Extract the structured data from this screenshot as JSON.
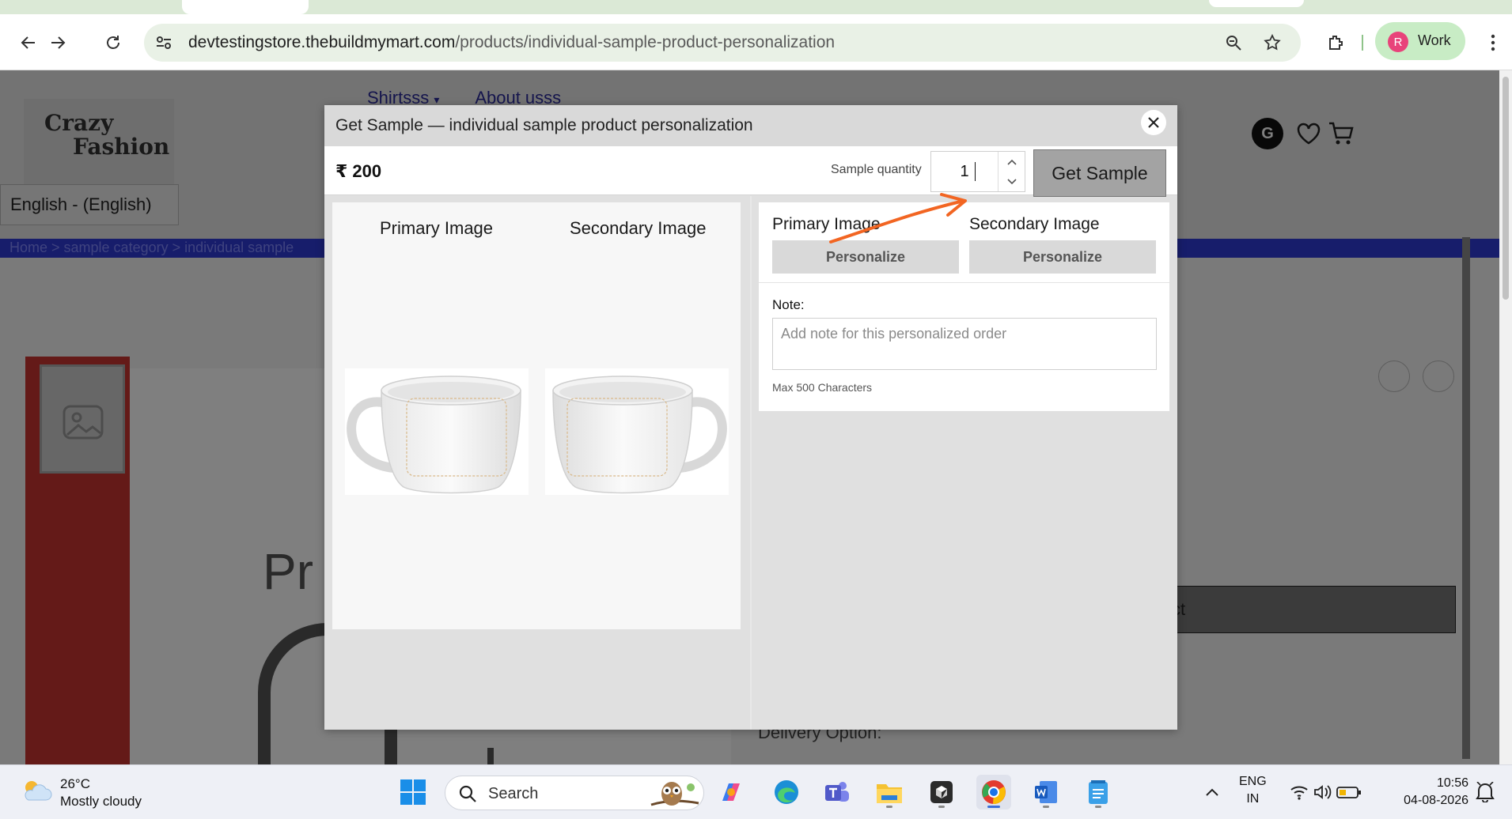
{
  "browser": {
    "url_domain": "devtestingstore.thebuildmymart.com",
    "url_path": "/products/individual-sample-product-personalization",
    "profile_initial": "R",
    "profile_label": "Work"
  },
  "page": {
    "logo_line1": "Crazy",
    "logo_line2": "Fashion",
    "nav_items": [
      "Shirtsss",
      "About usss"
    ],
    "nav_caret": "▾",
    "language": "English - (English)",
    "account_initial": "G",
    "breadcrumb": "Home  >  sample category  >  individual sample",
    "product_text_fragment": "Pr",
    "right_button_fragment": "ct",
    "delivery_label": "Delivery Option:"
  },
  "modal": {
    "title": "Get Sample — individual sample product personalization",
    "price": "₹ 200",
    "qty_label": "Sample quantity",
    "qty_value": "1",
    "get_sample_label": "Get Sample",
    "preview": {
      "primary_label": "Primary Image",
      "secondary_label": "Secondary Image"
    },
    "personalize": {
      "primary_label": "Primary Image",
      "secondary_label": "Secondary Image",
      "button_label": "Personalize",
      "note_label": "Note:",
      "note_placeholder": "Add note for this personalized order",
      "max_chars": "Max 500 Characters"
    }
  },
  "taskbar": {
    "temperature": "26°C",
    "weather": "Mostly cloudy",
    "search_label": "Search",
    "lang_line1": "ENG",
    "lang_line2": "IN",
    "time": "10:56",
    "date": "04-08-2026"
  },
  "colors": {
    "accent_annotation": "#f26522",
    "browser_accent": "#c8ecc5",
    "get_sample_btn": "#a3a3a3"
  }
}
